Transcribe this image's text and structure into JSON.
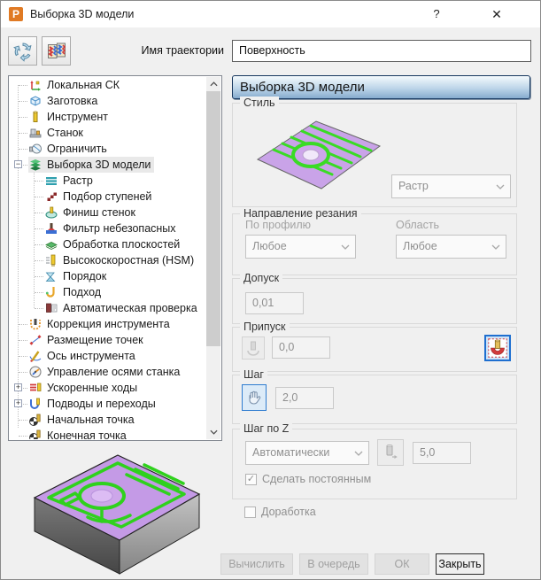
{
  "window": {
    "logo": "P",
    "title": "Выборка 3D модели",
    "help": "?",
    "close": "✕"
  },
  "toolbar": {
    "trajectory_label": "Имя траектории",
    "trajectory_value": "Поверхность",
    "buttons": [
      {
        "icon": "recalculate-icon"
      },
      {
        "icon": "pattern-cards-icon"
      }
    ]
  },
  "tree": {
    "items": [
      {
        "label": "Локальная СК",
        "icon": "local-cs-icon",
        "level": 1,
        "expander": "",
        "selected": false
      },
      {
        "label": "Заготовка",
        "icon": "workpiece-icon",
        "level": 1,
        "expander": "",
        "selected": false
      },
      {
        "label": "Инструмент",
        "icon": "tool-icon",
        "level": 1,
        "expander": "",
        "selected": false
      },
      {
        "label": "Станок",
        "icon": "machine-icon",
        "level": 1,
        "expander": "",
        "selected": false
      },
      {
        "label": "Ограничить",
        "icon": "limit-icon",
        "level": 1,
        "expander": "",
        "selected": false
      },
      {
        "label": "Выборка 3D модели",
        "icon": "roughing-3d-icon",
        "level": 1,
        "expander": "minus",
        "selected": true
      },
      {
        "label": "Растр",
        "icon": "raster-icon",
        "level": 2,
        "expander": "",
        "selected": false
      },
      {
        "label": "Подбор ступеней",
        "icon": "step-pickout-icon",
        "level": 2,
        "expander": "",
        "selected": false
      },
      {
        "label": "Финиш стенок",
        "icon": "wall-finish-icon",
        "level": 2,
        "expander": "",
        "selected": false
      },
      {
        "label": "Фильтр небезопасных",
        "icon": "unsafe-filter-icon",
        "level": 2,
        "expander": "",
        "selected": false
      },
      {
        "label": "Обработка плоскостей",
        "icon": "planes-machining-icon",
        "level": 2,
        "expander": "",
        "selected": false
      },
      {
        "label": "Высокоскоростная (HSM)",
        "icon": "hsm-icon",
        "level": 2,
        "expander": "",
        "selected": false
      },
      {
        "label": "Порядок",
        "icon": "order-icon",
        "level": 2,
        "expander": "",
        "selected": false
      },
      {
        "label": "Подход",
        "icon": "approach-icon",
        "level": 2,
        "expander": "",
        "selected": false
      },
      {
        "label": "Автоматическая проверка",
        "icon": "auto-check-icon",
        "level": 2,
        "expander": "",
        "selected": false
      },
      {
        "label": "Коррекция инструмента",
        "icon": "tool-correction-icon",
        "level": 1,
        "expander": "",
        "selected": false
      },
      {
        "label": "Размещение точек",
        "icon": "points-placement-icon",
        "level": 1,
        "expander": "",
        "selected": false
      },
      {
        "label": "Ось инструмента",
        "icon": "tool-axis-icon",
        "level": 1,
        "expander": "",
        "selected": false
      },
      {
        "label": "Управление осями станка",
        "icon": "machine-axes-icon",
        "level": 1,
        "expander": "",
        "selected": false
      },
      {
        "label": "Ускоренные ходы",
        "icon": "rapid-moves-icon",
        "level": 1,
        "expander": "plus",
        "selected": false
      },
      {
        "label": "Подводы и переходы",
        "icon": "leads-links-icon",
        "level": 1,
        "expander": "plus",
        "selected": false
      },
      {
        "label": "Начальная точка",
        "icon": "start-point-icon",
        "level": 1,
        "expander": "",
        "selected": false
      },
      {
        "label": "Конечная точка",
        "icon": "end-point-icon",
        "level": 1,
        "expander": "",
        "selected": false
      }
    ]
  },
  "panel": {
    "header": "Выборка 3D модели",
    "style_group": {
      "label": "Стиль",
      "dropdown_value": "Растр"
    },
    "direction_group": {
      "label": "Направление резания",
      "profile_label": "По профилю",
      "profile_value": "Любое",
      "area_label": "Область",
      "area_value": "Любое"
    },
    "tolerance_group": {
      "label": "Допуск",
      "value": "0,01"
    },
    "stock_group": {
      "label": "Припуск",
      "value": "0,0",
      "button_icon": "stock-tool-icon",
      "right_button_icon": "fillet-check-icon"
    },
    "step_group": {
      "label": "Шаг",
      "value": "2,0",
      "button_icon": "manual-hand-icon"
    },
    "stepz_group": {
      "label": "Шаг по Z",
      "mode_value": "Автоматически",
      "value": "5,0",
      "button_icon": "tool-step-icon",
      "checkbox_label": "Сделать постоянным",
      "checkbox_checked": true
    },
    "rework_checkbox": {
      "label": "Доработка",
      "checked": false
    }
  },
  "footer": {
    "buttons": [
      {
        "label": "Вычислить",
        "enabled": false
      },
      {
        "label": "В очередь",
        "enabled": false
      },
      {
        "label": "ОК",
        "enabled": false
      },
      {
        "label": "Закрыть",
        "enabled": true
      }
    ]
  },
  "colors": {
    "dialog_bg": "#f0f0f0",
    "header_gradient_top": "#f5fafd",
    "header_gradient_bottom": "#86abce",
    "header_border": "#17375e",
    "accent_blue": "#1e6fd0",
    "tree_selection_bg": "#e9e9e9",
    "toolpath_green": "#2fd11d",
    "model_lavender": "#c9a3e8",
    "disabled_text": "#8f8f8f"
  }
}
